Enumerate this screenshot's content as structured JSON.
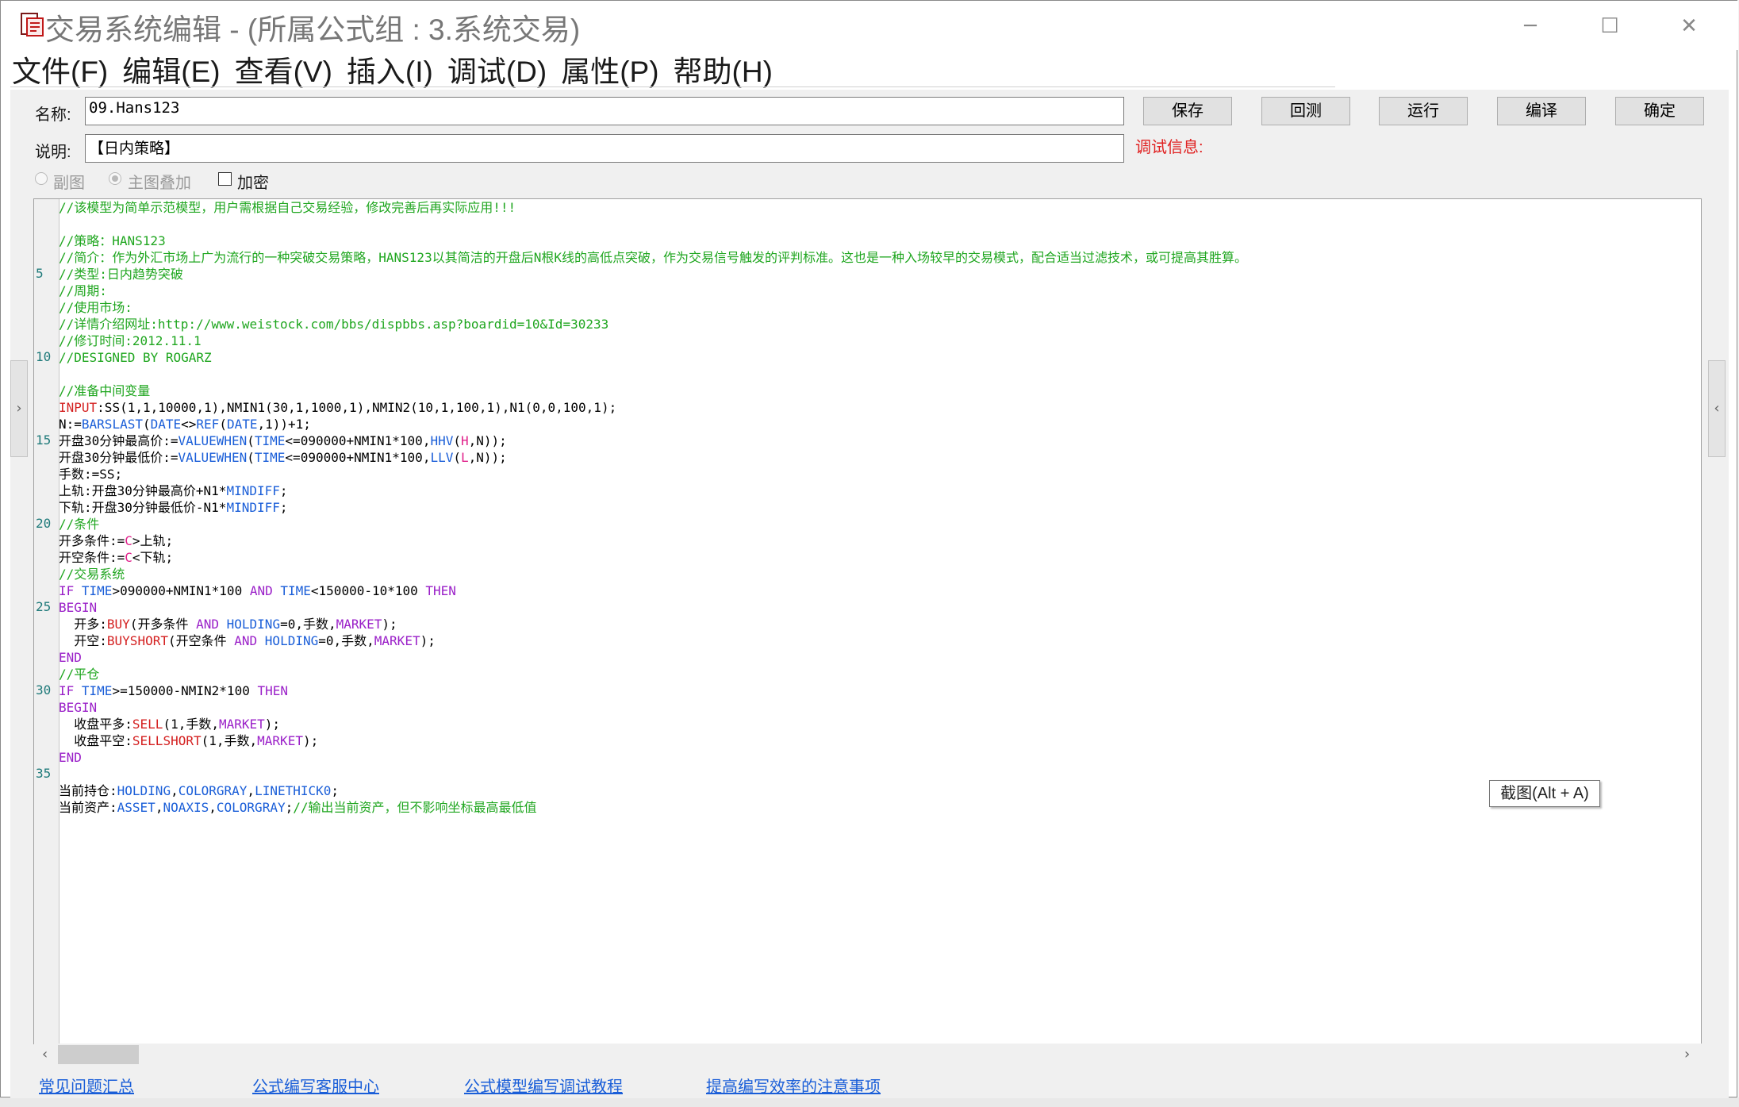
{
  "window": {
    "title": "交易系统编辑 - (所属公式组 : 3.系统交易)",
    "minimize_glyph": "─",
    "maximize_glyph": "☐",
    "close_glyph": "✕"
  },
  "menu": [
    "文件(F)",
    "编辑(E)",
    "查看(V)",
    "插入(I)",
    "调试(D)",
    "属性(P)",
    "帮助(H)"
  ],
  "form": {
    "name_label": "名称:",
    "name_value": "09.Hans123",
    "desc_label": "说明:",
    "desc_value": "【日内策略】",
    "debug_label": "调试信息:"
  },
  "buttons": {
    "save": "保存",
    "backtest": "回测",
    "run": "运行",
    "compile": "编译",
    "ok": "确定"
  },
  "options": {
    "subplot": "副图",
    "main_overlay": "主图叠加",
    "encrypt": "加密"
  },
  "line_numbers": [
    "5",
    "10",
    "15",
    "20",
    "25",
    "30",
    "35"
  ],
  "code_lines": [
    [
      [
        "cm",
        "//该模型为简单示范模型，用户需根据自己交易经验，修改完善后再实际应用!!!"
      ]
    ],
    [],
    [
      [
        "cm",
        "//策略：HANS123"
      ]
    ],
    [
      [
        "cm",
        "//简介：作为外汇市场上广为流行的一种突破交易策略，HANS123以其简洁的开盘后N根K线的高低点突破，作为交易信号触发的评判标准。这也是一种入场较早的交易模式，配合适当过滤技术，或可提高其胜算。"
      ]
    ],
    [
      [
        "cm",
        "//类型:日内趋势突破"
      ]
    ],
    [
      [
        "cm",
        "//周期:"
      ]
    ],
    [
      [
        "cm",
        "//使用市场:"
      ]
    ],
    [
      [
        "cm",
        "//详情介绍网址:http://www.weistock.com/bbs/dispbbs.asp?boardid=10&Id=30233"
      ]
    ],
    [
      [
        "cm",
        "//修订时间:2012.11.1"
      ]
    ],
    [
      [
        "cm",
        "//DESIGNED BY ROGARZ"
      ]
    ],
    [],
    [
      [
        "cm",
        "//准备中间变量"
      ]
    ],
    [
      [
        "kr",
        "INPUT"
      ],
      [
        "",
        ":SS(1,1,10000,1),NMIN1(30,1,1000,1),NMIN2(10,1,100,1),N1(0,0,100,1);"
      ]
    ],
    [
      [
        "",
        "N:="
      ],
      [
        "kb",
        "BARSLAST"
      ],
      [
        "",
        "("
      ],
      [
        "kb",
        "DATE"
      ],
      [
        "",
        "<>"
      ],
      [
        "kb",
        "REF"
      ],
      [
        "",
        "("
      ],
      [
        "kb",
        "DATE"
      ],
      [
        "",
        ",1))+1;"
      ]
    ],
    [
      [
        "",
        "开盘30分钟最高价:="
      ],
      [
        "kb",
        "VALUEWHEN"
      ],
      [
        "",
        "("
      ],
      [
        "kb",
        "TIME"
      ],
      [
        "",
        "<=090000+NMIN1*100,"
      ],
      [
        "kb",
        "HHV"
      ],
      [
        "",
        "("
      ],
      [
        "kf",
        "H"
      ],
      [
        "",
        ",N));"
      ]
    ],
    [
      [
        "",
        "开盘30分钟最低价:="
      ],
      [
        "kb",
        "VALUEWHEN"
      ],
      [
        "",
        "("
      ],
      [
        "kb",
        "TIME"
      ],
      [
        "",
        "<=090000+NMIN1*100,"
      ],
      [
        "kb",
        "LLV"
      ],
      [
        "",
        "("
      ],
      [
        "kf",
        "L"
      ],
      [
        "",
        ",N));"
      ]
    ],
    [
      [
        "",
        "手数:=SS;"
      ]
    ],
    [
      [
        "",
        "上轨:开盘30分钟最高价+N1*"
      ],
      [
        "kb",
        "MINDIFF"
      ],
      [
        "",
        ";"
      ]
    ],
    [
      [
        "",
        "下轨:开盘30分钟最低价-N1*"
      ],
      [
        "kb",
        "MINDIFF"
      ],
      [
        "",
        ";"
      ]
    ],
    [
      [
        "cm",
        "//条件"
      ]
    ],
    [
      [
        "",
        "开多条件:="
      ],
      [
        "kf",
        "C"
      ],
      [
        "",
        ">上轨;"
      ]
    ],
    [
      [
        "",
        "开空条件:="
      ],
      [
        "kf",
        "C"
      ],
      [
        "",
        "<下轨;"
      ]
    ],
    [
      [
        "cm",
        "//交易系统"
      ]
    ],
    [
      [
        "kp",
        "IF"
      ],
      [
        "",
        " "
      ],
      [
        "kb",
        "TIME"
      ],
      [
        "",
        ">090000+NMIN1*100 "
      ],
      [
        "kp",
        "AND"
      ],
      [
        "",
        " "
      ],
      [
        "kb",
        "TIME"
      ],
      [
        "",
        "<150000-10*100 "
      ],
      [
        "kp",
        "THEN"
      ]
    ],
    [
      [
        "kp",
        "BEGIN"
      ]
    ],
    [
      [
        "",
        "  开多:"
      ],
      [
        "kr",
        "BUY"
      ],
      [
        "",
        "(开多条件 "
      ],
      [
        "kp",
        "AND"
      ],
      [
        "",
        " "
      ],
      [
        "kb",
        "HOLDING"
      ],
      [
        "",
        "=0,手数,"
      ],
      [
        "kp",
        "MARKET"
      ],
      [
        "",
        ");"
      ]
    ],
    [
      [
        "",
        "  开空:"
      ],
      [
        "kr",
        "BUYSHORT"
      ],
      [
        "",
        "(开空条件 "
      ],
      [
        "kp",
        "AND"
      ],
      [
        "",
        " "
      ],
      [
        "kb",
        "HOLDING"
      ],
      [
        "",
        "=0,手数,"
      ],
      [
        "kp",
        "MARKET"
      ],
      [
        "",
        ");"
      ]
    ],
    [
      [
        "kp",
        "END"
      ]
    ],
    [
      [
        "cm",
        "//平仓"
      ]
    ],
    [
      [
        "kp",
        "IF"
      ],
      [
        "",
        " "
      ],
      [
        "kb",
        "TIME"
      ],
      [
        "",
        ">=150000-NMIN2*100 "
      ],
      [
        "kp",
        "THEN"
      ]
    ],
    [
      [
        "kp",
        "BEGIN"
      ]
    ],
    [
      [
        "",
        "  收盘平多:"
      ],
      [
        "kr",
        "SELL"
      ],
      [
        "",
        "(1,手数,"
      ],
      [
        "kp",
        "MARKET"
      ],
      [
        "",
        ");"
      ]
    ],
    [
      [
        "",
        "  收盘平空:"
      ],
      [
        "kr",
        "SELLSHORT"
      ],
      [
        "",
        "(1,手数,"
      ],
      [
        "kp",
        "MARKET"
      ],
      [
        "",
        ");"
      ]
    ],
    [
      [
        "kp",
        "END"
      ]
    ],
    [],
    [
      [
        "",
        "当前持仓:"
      ],
      [
        "kb",
        "HOLDING"
      ],
      [
        "",
        ","
      ],
      [
        "kb",
        "COLORGRAY"
      ],
      [
        "",
        ","
      ],
      [
        "kb",
        "LINETHICK0"
      ],
      [
        "",
        ";"
      ]
    ],
    [
      [
        "",
        "当前资产:"
      ],
      [
        "kb",
        "ASSET"
      ],
      [
        "",
        ","
      ],
      [
        "kb",
        "NOAXIS"
      ],
      [
        "",
        ","
      ],
      [
        "kb",
        "COLORGRAY"
      ],
      [
        "",
        ";"
      ],
      [
        "cm",
        "//输出当前资产，但不影响坐标最高最低值"
      ]
    ]
  ],
  "scrollbar": {
    "left_arrow": "‹",
    "right_arrow": "›"
  },
  "side_tabs": {
    "left": "›",
    "right": "‹"
  },
  "tooltip": "截图(Alt + A)",
  "links": [
    "常见问题汇总",
    "公式编写客服中心",
    "公式模型编写调试教程",
    "提高编写效率的注意事项"
  ],
  "colors": {
    "comment": "#1fa61f",
    "function_blue": "#1a5ed8",
    "keyword_purple": "#9a1fc8",
    "order_red": "#d42020",
    "price_pink": "#e0208a",
    "debug_label": "#e02020",
    "link": "#1a5ed8"
  }
}
